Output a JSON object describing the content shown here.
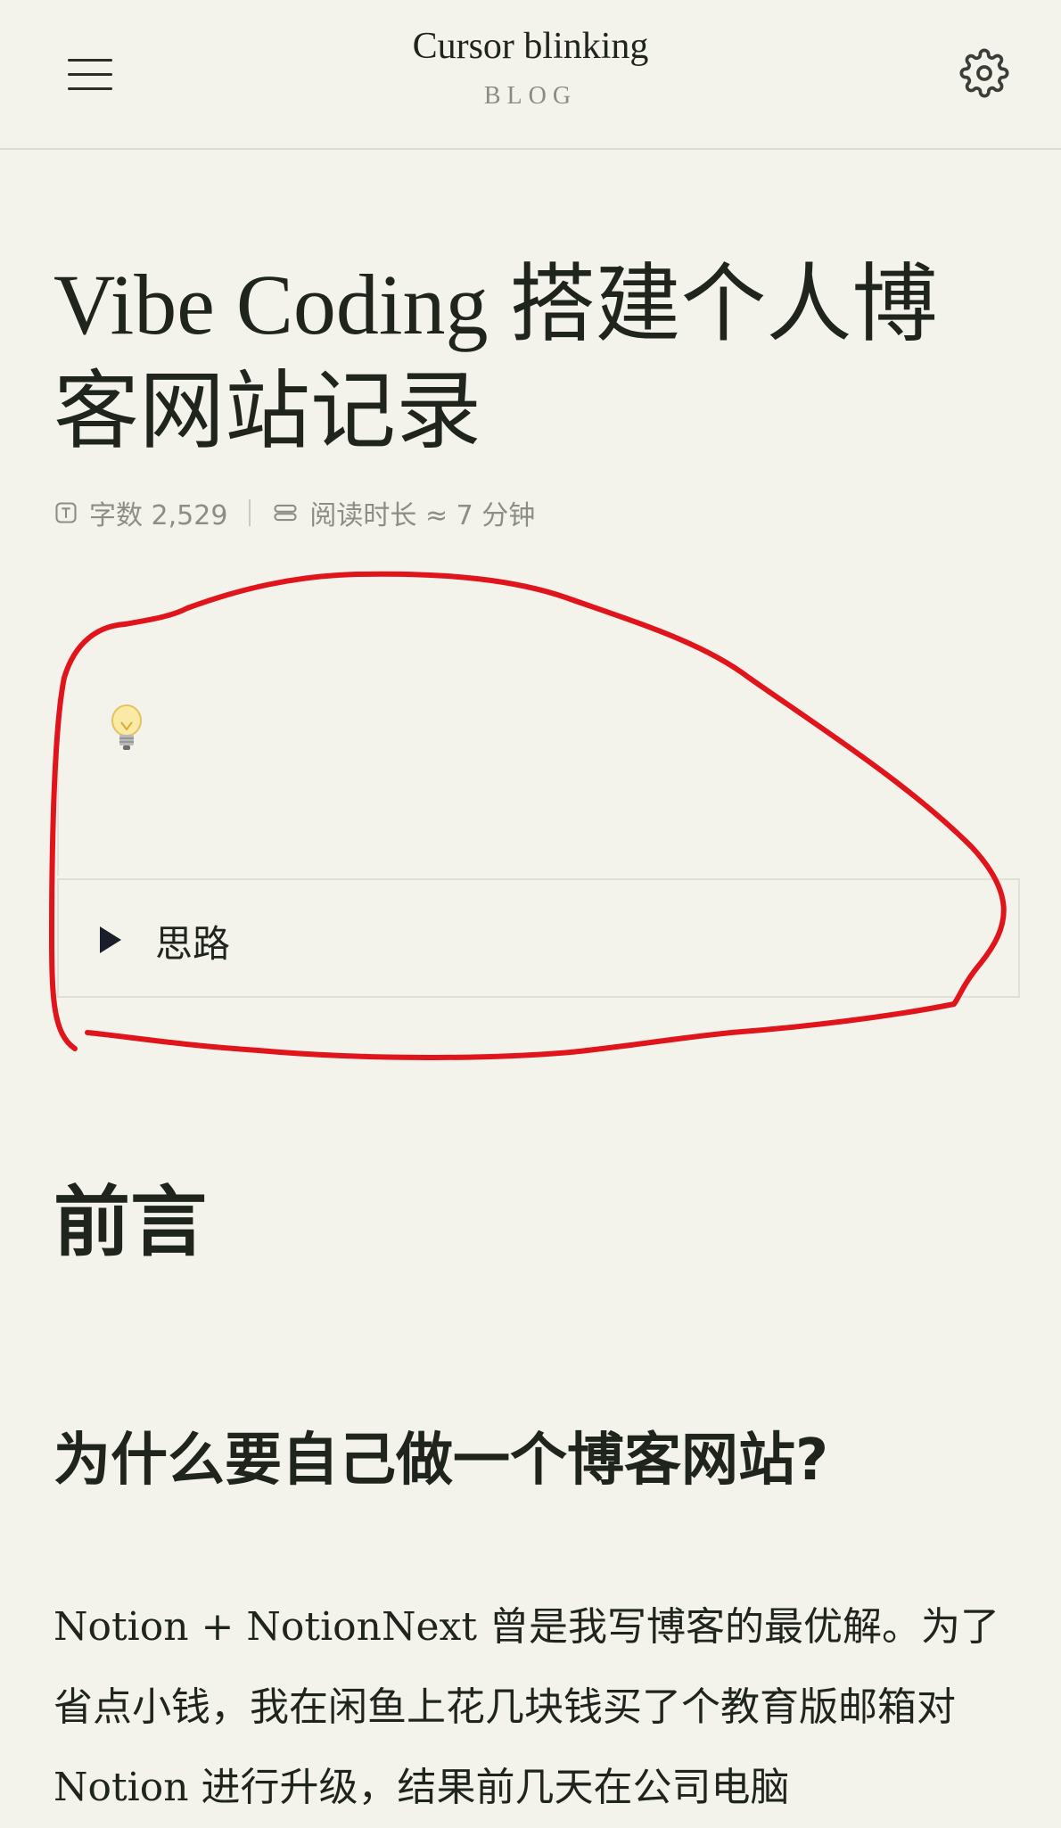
{
  "header": {
    "site_title": "Cursor blinking",
    "site_subtitle": "BLOG",
    "menu_icon": "hamburger-menu-icon",
    "settings_icon": "gear-icon"
  },
  "article": {
    "title": "Vibe Coding 搭建个人博客网站记录",
    "meta": {
      "word_count_label": "字数 2,529",
      "read_time_label": "阅读时长 ≈ 7 分钟"
    },
    "callout": {
      "icon": "lightbulb-icon",
      "toggle_label": "思路"
    },
    "heading_1": "前言",
    "heading_2": "为什么要自己做一个博客网站?",
    "paragraph": "Notion + NotionNext 曾是我写博客的最优解。为了省点小钱，我在闲鱼上花几块钱买了个教育版邮箱对 Notion 进行升级，结果前几天在公司电脑"
  },
  "colors": {
    "background": "#f3f3ec",
    "text": "#1f241d",
    "muted": "#8b8d86",
    "annotation": "#e0151b"
  }
}
